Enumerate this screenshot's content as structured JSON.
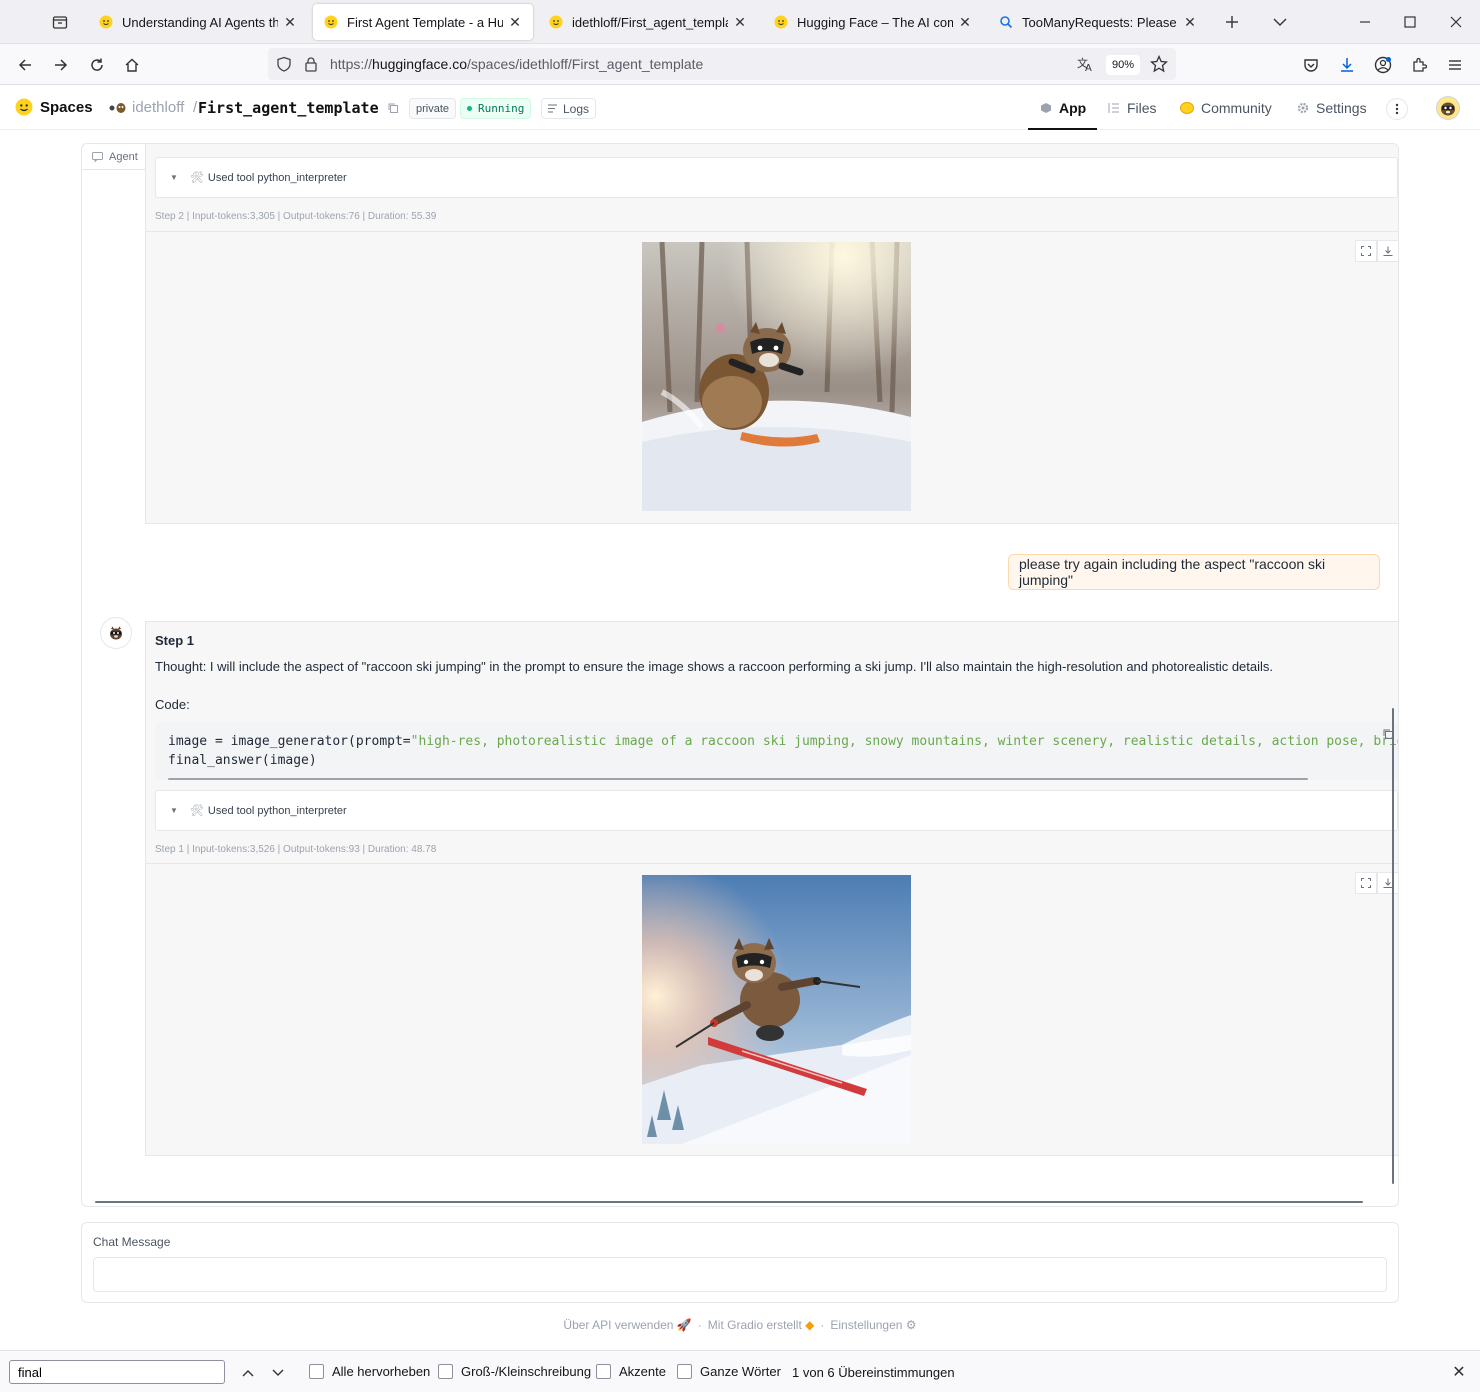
{
  "browser": {
    "tabs": [
      {
        "title": "Understanding AI Agents through",
        "favicon": "hf-smile-icon"
      },
      {
        "title": "First Agent Template - a Huggin",
        "favicon": "hf-smile-icon",
        "active": true
      },
      {
        "title": "idethloff/First_agent_template ·",
        "favicon": "hf-smile-icon"
      },
      {
        "title": "Hugging Face – The AI commun",
        "favicon": "hf-smile-icon"
      },
      {
        "title": "TooManyRequests: Please log in",
        "favicon": "search-icon"
      }
    ],
    "url_prefix": "https://",
    "url_domain": "huggingface.co",
    "url_path": "/spaces/idethloff/First_agent_template",
    "zoom": "90%"
  },
  "hf": {
    "spaces_label": "Spaces",
    "owner": "idethloff",
    "separator": "/",
    "repo": "First_agent_template",
    "private_badge": "private",
    "status": "Running",
    "logs": "Logs",
    "nav": {
      "app": "App",
      "files": "Files",
      "community": "Community",
      "settings": "Settings"
    }
  },
  "chat": {
    "agent_label": "Agent",
    "prev_tool_label": "Used tool python_interpreter",
    "prev_step_meta": "Step 2 | Input-tokens:3,305 | Output-tokens:76 | Duration: 55.39",
    "user_message": "please try again including the aspect \"raccoon ski jumping\"",
    "step_title": "Step 1",
    "thought": "Thought: I will include the aspect of \"raccoon ski jumping\" in the prompt to ensure the image shows a raccoon performing a ski jump. I'll also maintain the high-resolution and photorealistic details.",
    "code_label": "Code:",
    "code_line1_pre": "image = image_generator(prompt=",
    "code_line1_str": "\"high-res, photorealistic image of a raccoon ski jumping, snowy mountains, winter scenery, realistic details, action pose, bright sunlight\")",
    "code_line2": "final_answer(image)",
    "tool_label": "Used tool python_interpreter",
    "step_meta": "Step 1 | Input-tokens:3,526 | Output-tokens:93 | Duration: 48.78"
  },
  "input": {
    "label": "Chat Message",
    "value": "",
    "placeholder": ""
  },
  "footer": {
    "api": "Über API verwenden",
    "gradio": "Mit Gradio erstellt",
    "settings": "Einstellungen",
    "dot": "·"
  },
  "findbar": {
    "query": "final",
    "highlight_all": "Alle hervorheben",
    "match_case": "Groß-/Kleinschreibung",
    "accents": "Akzente",
    "whole_words": "Ganze Wörter",
    "count": "1 von 6 Übereinstimmungen"
  }
}
